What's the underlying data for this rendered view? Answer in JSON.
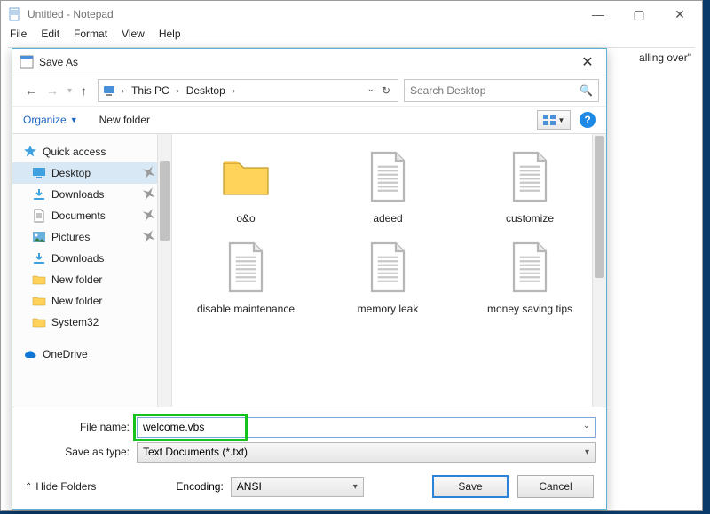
{
  "notepad": {
    "title": "Untitled - Notepad",
    "menu": [
      "File",
      "Edit",
      "Format",
      "View",
      "Help"
    ],
    "editor_line_fragment": "alling over\""
  },
  "saveas": {
    "title": "Save As",
    "nav": {
      "crumbs": [
        "This PC",
        "Desktop"
      ],
      "refresh_hint": "Refresh",
      "search_placeholder": "Search Desktop"
    },
    "toolbar": {
      "organize": "Organize",
      "newfolder": "New folder"
    },
    "sidebar": {
      "groups": [
        {
          "label": "Quick access",
          "icon": "star"
        },
        {
          "label": "Desktop",
          "icon": "desktop",
          "selected": true,
          "pin": true
        },
        {
          "label": "Downloads",
          "icon": "download",
          "pin": true
        },
        {
          "label": "Documents",
          "icon": "document",
          "pin": true
        },
        {
          "label": "Pictures",
          "icon": "pictures",
          "pin": true
        },
        {
          "label": "Downloads",
          "icon": "download"
        },
        {
          "label": "New folder",
          "icon": "folder"
        },
        {
          "label": "New folder",
          "icon": "folder"
        },
        {
          "label": "System32",
          "icon": "folder"
        },
        {
          "label": "OneDrive",
          "icon": "cloud",
          "head": true
        }
      ]
    },
    "files": [
      {
        "name": "o&o",
        "type": "folder"
      },
      {
        "name": "adeed",
        "type": "text"
      },
      {
        "name": "customize",
        "type": "text"
      },
      {
        "name": "disable maintenance",
        "type": "text"
      },
      {
        "name": "memory leak",
        "type": "text"
      },
      {
        "name": "money saving tips",
        "type": "text"
      }
    ],
    "form": {
      "filename_label": "File name:",
      "filename_value": "welcome.vbs",
      "type_label": "Save as type:",
      "type_value": "Text Documents (*.txt)",
      "encoding_label": "Encoding:",
      "encoding_value": "ANSI",
      "hide_folders": "Hide Folders",
      "save": "Save",
      "cancel": "Cancel"
    }
  }
}
